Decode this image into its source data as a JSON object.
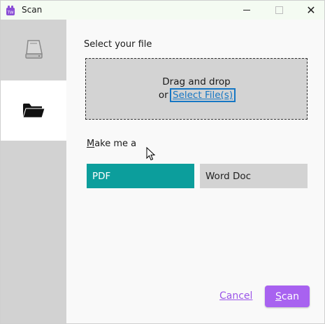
{
  "window": {
    "title": "Scan",
    "controls": {
      "minimize": "minimize",
      "maximize": "maximize",
      "close": "✕"
    }
  },
  "sidebar": {
    "items": [
      {
        "name": "scanner",
        "icon": "scanner-icon",
        "selected": false
      },
      {
        "name": "folder",
        "icon": "folder-icon",
        "selected": true
      }
    ]
  },
  "file_select": {
    "label": "Select your file",
    "drag_text": "Drag and drop",
    "or_text": "or",
    "link_text": "Select File(s)"
  },
  "output": {
    "label_first": "M",
    "label_rest": "ake me a",
    "options": [
      {
        "label": "PDF",
        "selected": true
      },
      {
        "label": "Word Doc",
        "selected": false
      }
    ]
  },
  "actions": {
    "cancel_first": "C",
    "cancel_rest": "ancel",
    "scan_first": "S",
    "scan_rest": "can"
  },
  "colors": {
    "accent_purple": "#a862f0",
    "selected_teal": "#0c9e9c",
    "link_blue": "#1677c4"
  }
}
